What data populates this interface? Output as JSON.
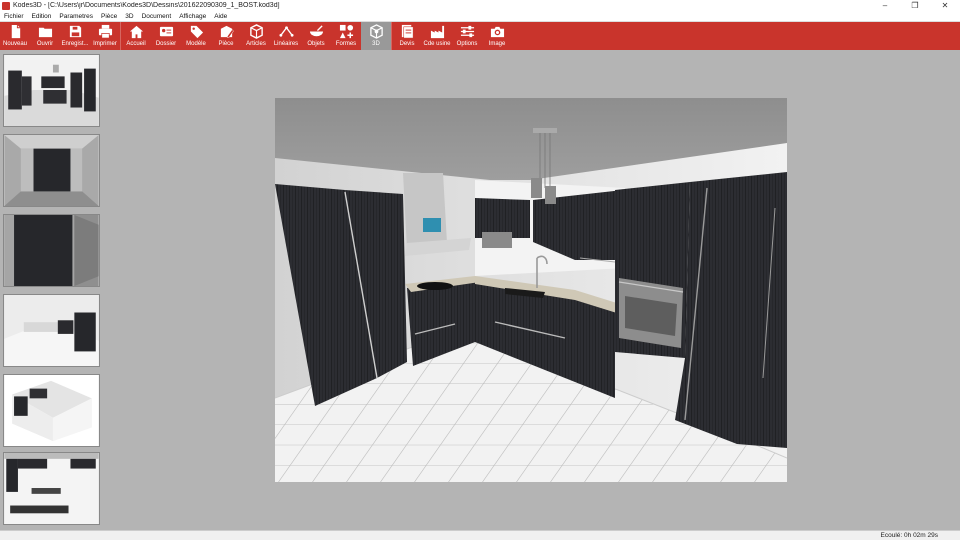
{
  "window": {
    "title": "Kodes3D - [C:\\Users\\jr\\Documents\\Kodes3D\\Dessins\\201622090309_1_BOST.kod3d]",
    "minimize_icon": "minimize-icon",
    "maximize_icon": "maximize-icon",
    "close_icon": "close-icon"
  },
  "menu": [
    "Fichier",
    "Edition",
    "Parametres",
    "Pièce",
    "3D",
    "Document",
    "Affichage",
    "Aide"
  ],
  "toolbar": [
    {
      "label": "Nouveau",
      "icon": "new-document-icon"
    },
    {
      "label": "Ouvrir",
      "icon": "open-folder-icon"
    },
    {
      "label": "Enregist...",
      "icon": "save-icon"
    },
    {
      "label": "Imprimer",
      "icon": "print-icon"
    },
    {
      "label": "Accueil",
      "icon": "home-icon"
    },
    {
      "label": "Dossier",
      "icon": "client-card-icon"
    },
    {
      "label": "Modèle",
      "icon": "tags-icon"
    },
    {
      "label": "Pièce",
      "icon": "room-edit-icon"
    },
    {
      "label": "Articles",
      "icon": "articles-cube-icon"
    },
    {
      "label": "Linéaires",
      "icon": "linear-icon"
    },
    {
      "label": "Objets",
      "icon": "objects-icon"
    },
    {
      "label": "Formes",
      "icon": "shapes-icon"
    },
    {
      "label": "3D",
      "icon": "cube-3d-icon",
      "active": true
    },
    {
      "label": "Devis",
      "icon": "quote-document-icon"
    },
    {
      "label": "Cde usine",
      "icon": "factory-order-icon"
    },
    {
      "label": "Options",
      "icon": "options-sliders-icon"
    },
    {
      "label": "Image",
      "icon": "camera-icon"
    }
  ],
  "thumbnails": [
    "view-1",
    "view-2",
    "view-3",
    "view-4",
    "view-5",
    "view-6"
  ],
  "status": {
    "elapsed": "Ecoulé: 0h 02m 29s"
  },
  "colors": {
    "accent": "#c9342c",
    "cabinet": "#26272b",
    "background": "#b4b4b4"
  }
}
